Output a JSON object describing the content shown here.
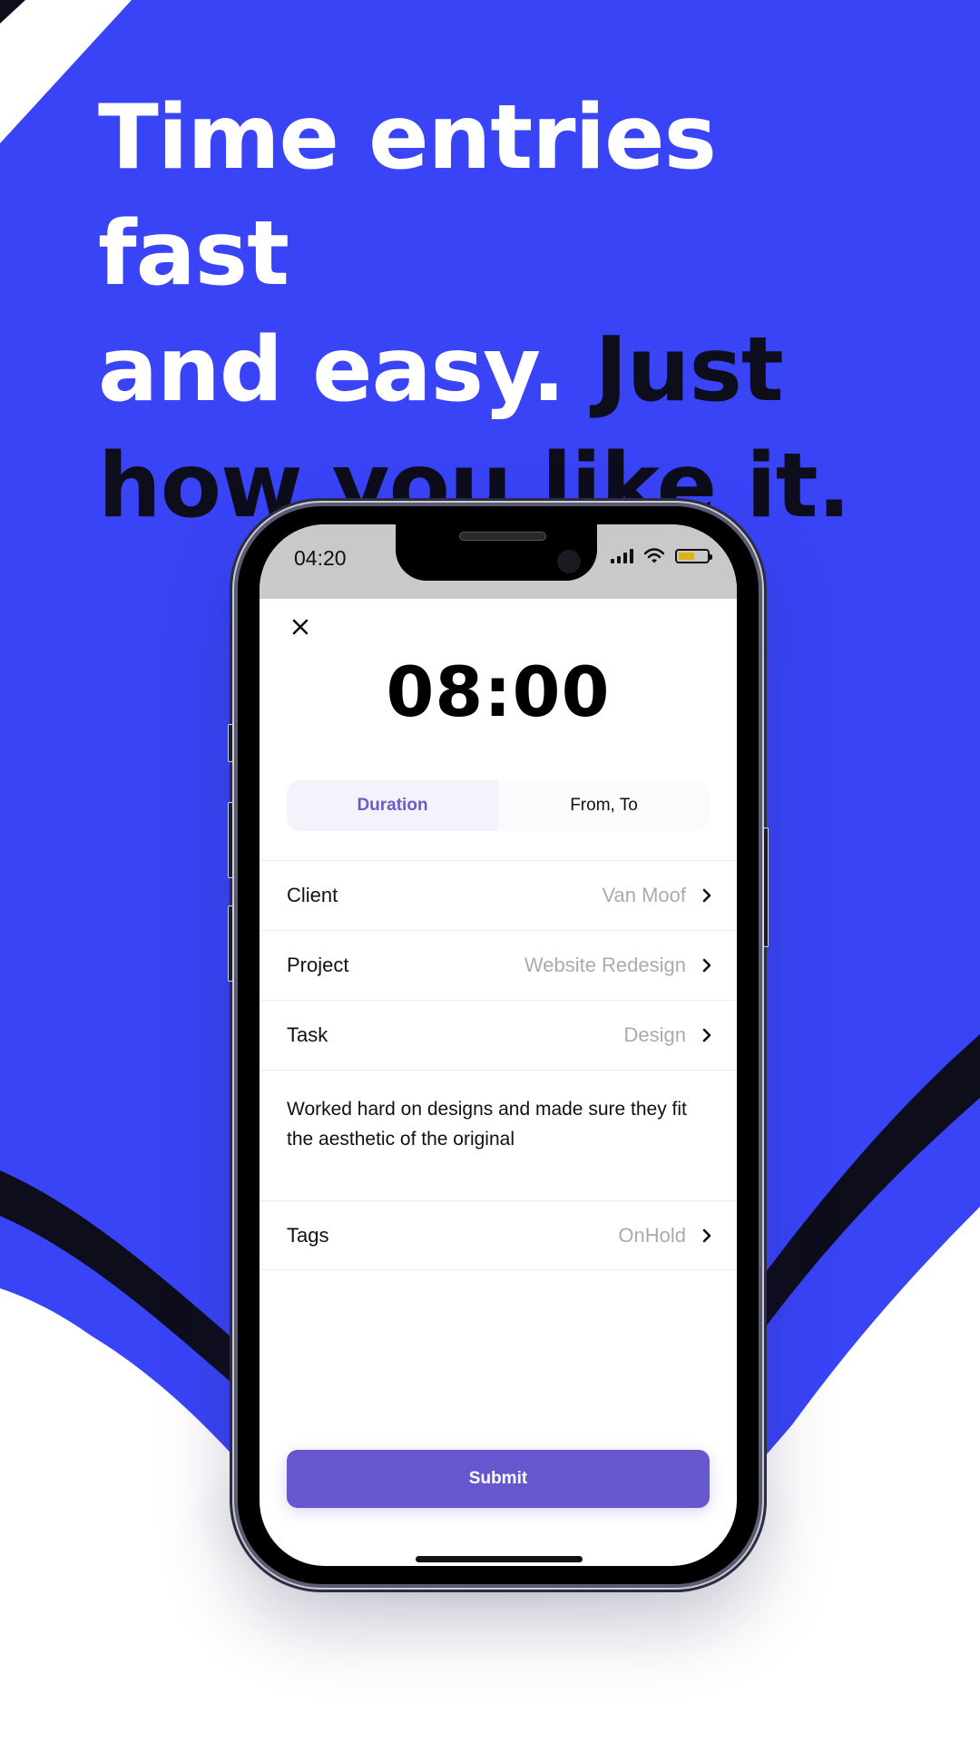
{
  "colors": {
    "brand_blue": "#3944f7",
    "dark": "#0e0d1c",
    "accent_purple": "#6558cf",
    "muted_text": "#ababab"
  },
  "headline": {
    "white_part": "Time entries fast and easy.",
    "dark_part": "Just how you like it.",
    "line1": "Time entries fast",
    "line2_white": "and easy.",
    "line2_dark": " Just",
    "line3": "how you like it."
  },
  "status_bar": {
    "time": "04:20",
    "icons": [
      "signal-icon",
      "wifi-icon",
      "battery-icon"
    ],
    "battery_level": 0.55
  },
  "screen": {
    "close_icon": "close-icon",
    "duration_display": "08:00",
    "mode_tabs": [
      {
        "label": "Duration",
        "active": true
      },
      {
        "label": "From, To",
        "active": false
      }
    ],
    "fields": [
      {
        "label": "Client",
        "value": "Van Moof"
      },
      {
        "label": "Project",
        "value": "Website Redesign"
      },
      {
        "label": "Task",
        "value": "Design"
      }
    ],
    "notes": "Worked hard on designs and made sure they fit the aesthetic of the original",
    "tags": {
      "label": "Tags",
      "value": "OnHold"
    },
    "submit_label": "Submit"
  }
}
